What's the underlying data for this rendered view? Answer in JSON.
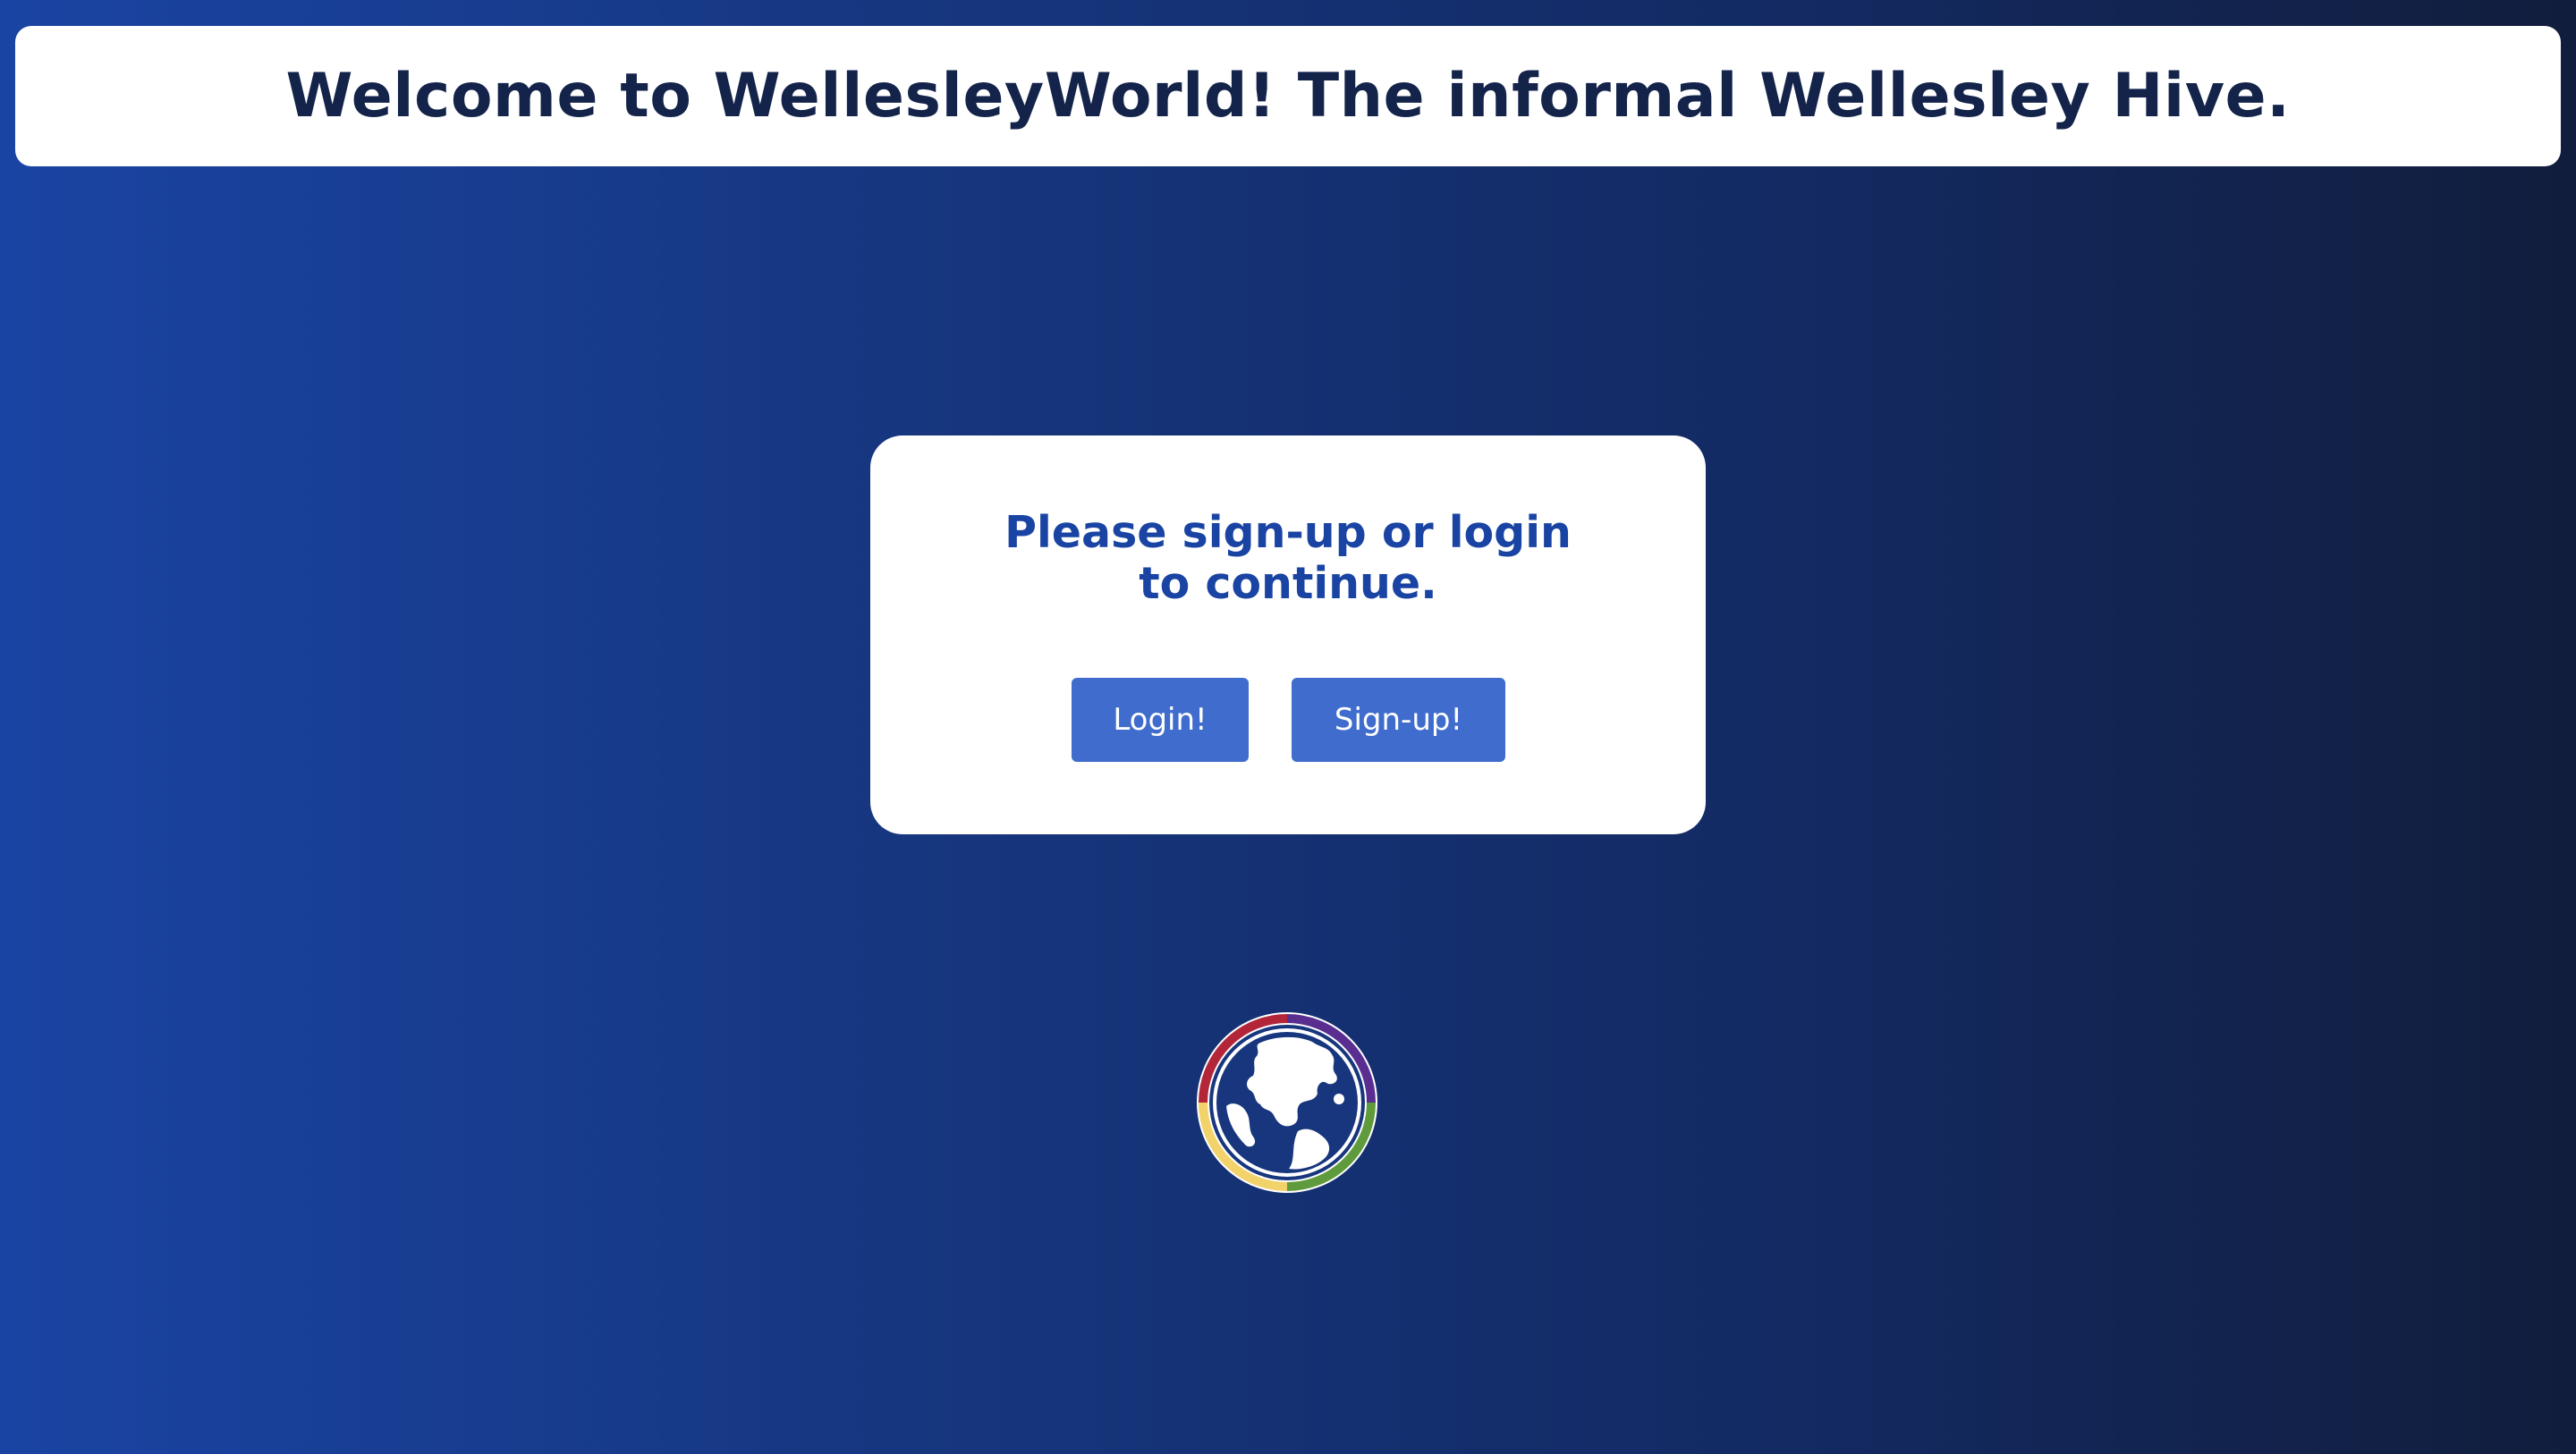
{
  "header": {
    "title": "Welcome to WellesleyWorld! The informal Wellesley Hive."
  },
  "auth_card": {
    "prompt": "Please sign-up or login to continue.",
    "login_label": "Login!",
    "signup_label": "Sign-up!"
  },
  "logo": {
    "icon": "globe-icon",
    "ring_colors": [
      "#b3263a",
      "#5a2d91",
      "#f2d26b",
      "#5f9b3c"
    ]
  },
  "colors": {
    "background_start": "#1a44a3",
    "background_end": "#111d3c",
    "heading_text": "#13234a",
    "accent_text": "#1a44a3",
    "button_fill": "#3f6ccd"
  }
}
